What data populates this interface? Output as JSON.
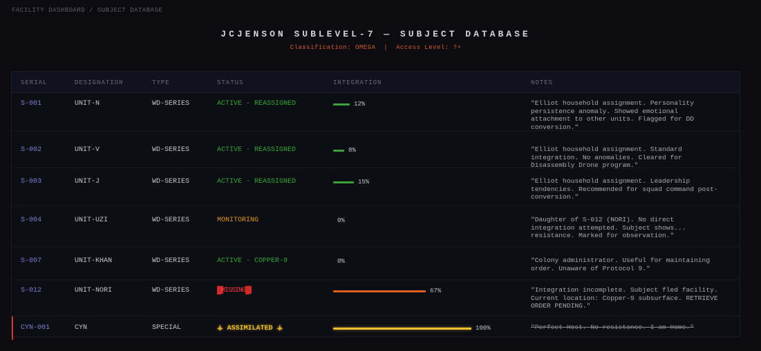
{
  "breadcrumb": "FACILITY DASHBOARD / SUBJECT DATABASE",
  "title": "JCJENSON SUBLEVEL-7 — SUBJECT DATABASE",
  "subtitle": "Classification: OMEGA  |  Access Level: 7+",
  "columns": [
    "SERIAL",
    "DESIGNATION",
    "TYPE",
    "STATUS",
    "INTEGRATION",
    "NOTES"
  ],
  "colors": {
    "active": "#35a836",
    "monitoring": "#e09a2a",
    "missing": "#ff3b3b",
    "assimilated": "#f0c030",
    "bar_green": "#3f9f3a",
    "bar_orange": "#e0601f",
    "bar_yellow": "#f0c030"
  },
  "rows": [
    {
      "serial": "S-001",
      "designation": "UNIT-N",
      "type": "WD-SERIES",
      "status": "ACTIVE - REASSIGNED",
      "status_kind": "active",
      "integration": 0.12,
      "integration_label": "12%",
      "bar_color": "green",
      "notes": "\"Elliot household assignment. Personality persistence anomaly. Showed emotional attachment to other units. Flagged for DD conversion.\""
    },
    {
      "serial": "S-002",
      "designation": "UNIT-V",
      "type": "WD-SERIES",
      "status": "ACTIVE - REASSIGNED",
      "status_kind": "active",
      "integration": 0.08,
      "integration_label": "8%",
      "bar_color": "green",
      "notes": "\"Elliot household assignment. Standard integration. No anomalies. Cleared for Disassembly Drone program.\""
    },
    {
      "serial": "S-003",
      "designation": "UNIT-J",
      "type": "WD-SERIES",
      "status": "ACTIVE - REASSIGNED",
      "status_kind": "active",
      "integration": 0.15,
      "integration_label": "15%",
      "bar_color": "green",
      "notes": "\"Elliot household assignment. Leadership tendencies. Recommended for squad command post-conversion.\""
    },
    {
      "serial": "S-004",
      "designation": "UNIT-UZI",
      "type": "WD-SERIES",
      "status": "MONITORING",
      "status_kind": "monitoring",
      "integration": 0.0,
      "integration_label": "0%",
      "bar_color": "green",
      "notes": "\"Daughter of S-012 (NORI). No direct integration attempted. Subject shows... resistance. Marked for observation.\""
    },
    {
      "serial": "S-007",
      "designation": "UNIT-KHAN",
      "type": "WD-SERIES",
      "status": "ACTIVE - COPPER-9",
      "status_kind": "active",
      "integration": 0.0,
      "integration_label": "0%",
      "bar_color": "green",
      "notes": "\"Colony administrator. Useful for maintaining order. Unaware of Protocol 9.\""
    },
    {
      "serial": "S-012",
      "designation": "UNIT-NORI",
      "type": "WD-SERIES",
      "status": "MISSING",
      "status_kind": "missing",
      "integration": 0.67,
      "integration_label": "67%",
      "bar_color": "orange",
      "notes": "\"Integration incomplete. Subject fled facility. Current location: Copper-9 subsurface. RETRIEVE ORDER PENDING.\""
    },
    {
      "serial": "CYN-001",
      "designation": "CYN",
      "type": "SPECIAL",
      "status": "ASSIMILATED",
      "status_kind": "assimilated",
      "integration": 1.0,
      "integration_label": "100%",
      "bar_color": "yellow",
      "notes": "\"Perfect Host. No resistance. I am Home.\""
    }
  ]
}
